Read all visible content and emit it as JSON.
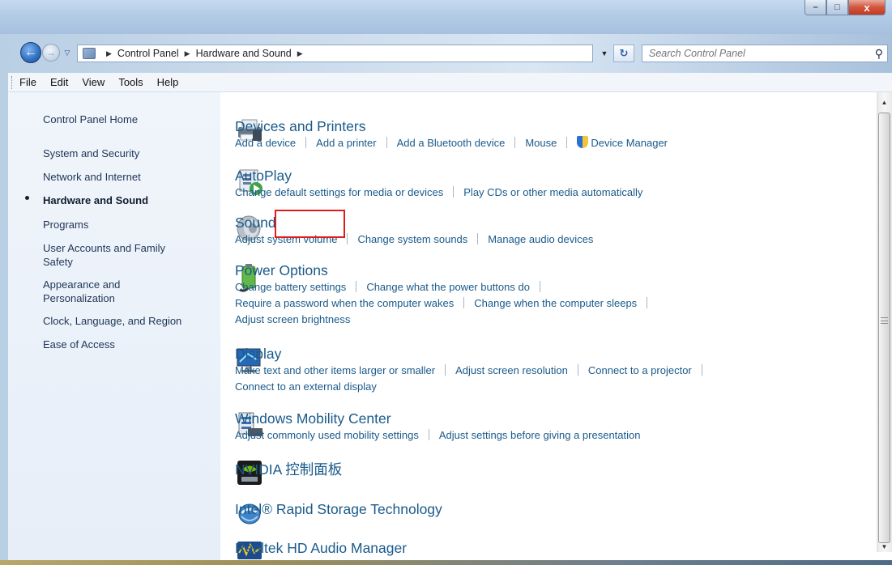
{
  "window": {
    "caption": {
      "minimize": "–",
      "maximize": "□",
      "close": "x"
    }
  },
  "navigation": {
    "back_glyph": "←",
    "forward_glyph": "→",
    "history_glyph": "▽",
    "refresh_glyph": "↻",
    "breadcrumb": [
      "Control Panel",
      "Hardware and Sound"
    ],
    "breadcrumb_separator": "▶",
    "dropdown_glyph": "▼",
    "search_placeholder": "Search Control Panel",
    "search_icon_glyph": "⚲"
  },
  "menu": [
    "File",
    "Edit",
    "View",
    "Tools",
    "Help"
  ],
  "sidebar": {
    "items": [
      {
        "label": "Control Panel Home",
        "active": false
      },
      {
        "label": "System and Security",
        "active": false
      },
      {
        "label": "Network and Internet",
        "active": false
      },
      {
        "label": "Hardware and Sound",
        "active": true
      },
      {
        "label": "Programs",
        "active": false
      },
      {
        "label": "User Accounts and Family Safety",
        "active": false
      },
      {
        "label": "Appearance and Personalization",
        "active": false
      },
      {
        "label": "Clock, Language, and Region",
        "active": false
      },
      {
        "label": "Ease of Access",
        "active": false
      }
    ]
  },
  "categories": [
    {
      "title": "Devices and Printers",
      "icon": "printer-icon",
      "link_rows": [
        [
          "Add a device",
          "Add a printer",
          "Add a Bluetooth device",
          "Mouse",
          "Device Manager"
        ]
      ]
    },
    {
      "title": "AutoPlay",
      "icon": "autoplay-icon",
      "link_rows": [
        [
          "Change default settings for media or devices",
          "Play CDs or other media automatically"
        ]
      ]
    },
    {
      "title": "Sound",
      "icon": "speaker-icon",
      "highlighted": true,
      "link_rows": [
        [
          "Adjust system volume",
          "Change system sounds",
          "Manage audio devices"
        ]
      ]
    },
    {
      "title": "Power Options",
      "icon": "battery-icon",
      "link_rows": [
        [
          "Change battery settings",
          "Change what the power buttons do"
        ],
        [
          "Require a password when the computer wakes",
          "Change when the computer sleeps"
        ],
        [
          "Adjust screen brightness"
        ]
      ]
    },
    {
      "title": "Display",
      "icon": "monitor-icon",
      "link_rows": [
        [
          "Make text and other items larger or smaller",
          "Adjust screen resolution",
          "Connect to a projector"
        ],
        [
          "Connect to an external display"
        ]
      ]
    },
    {
      "title": "Windows Mobility Center",
      "icon": "mobility-center-icon",
      "link_rows": [
        [
          "Adjust commonly used mobility settings",
          "Adjust settings before giving a presentation"
        ]
      ]
    },
    {
      "title": "NVIDIA 控制面板",
      "icon": "nvidia-icon",
      "link_rows": []
    },
    {
      "title": "Intel® Rapid Storage Technology",
      "icon": "intel-storage-icon",
      "link_rows": []
    },
    {
      "title": "Realtek HD Audio Manager",
      "icon": "realtek-audio-icon",
      "link_rows": []
    }
  ],
  "scrollbar": {
    "up_glyph": "▲",
    "down_glyph": "▼"
  },
  "colors": {
    "link": "#1a5a8a",
    "highlight_box": "#e01b1b",
    "sidebar_bg": "#e7eef8"
  }
}
